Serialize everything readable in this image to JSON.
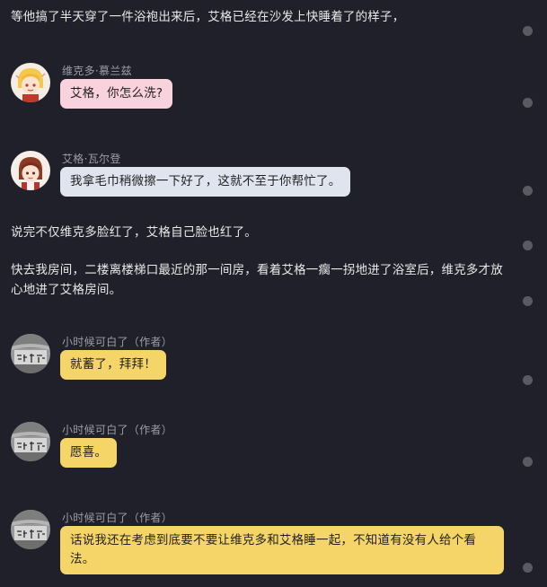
{
  "narration": [
    "等他搞了半天穿了一件浴袍出来后，艾格已经在沙发上快睡着了的样子，",
    "说完不仅维克多脸红了，艾格自己脸也红了。",
    "快去我房间，二楼离楼梯口最近的那一间房，看着艾格一瘸一拐地进了浴室后，维克多才放心地进了艾格房间。"
  ],
  "messages": [
    {
      "speaker": "维克多·慕兰兹",
      "text": "艾格，你怎么洗?",
      "avatar": "victor-avatar"
    },
    {
      "speaker": "艾格·瓦尔登",
      "text": "我拿毛巾稍微擦一下好了，这就不至于你帮忙了。",
      "avatar": "egg-avatar"
    },
    {
      "speaker": "小时候可白了（作者）",
      "text": "就蓄了，拜拜！",
      "avatar": "author-avatar"
    },
    {
      "speaker": "小时候可白了（作者）",
      "text": "愿喜。",
      "avatar": "author-avatar"
    },
    {
      "speaker": "小时候可白了（作者）",
      "text": "话说我还在考虑到底要不要让维克多和艾格睡一起，不知道有没有人给个看法。",
      "avatar": "author-avatar"
    }
  ],
  "colors": {
    "background": "#1f2029",
    "bubble_pink": "#f8d2dd",
    "bubble_blue": "#dfe4ef",
    "bubble_yellow": "#f6d568",
    "dot": "#5a5b62"
  },
  "icons": {
    "paragraph_marker": "paragraph-comment-dot-icon"
  }
}
